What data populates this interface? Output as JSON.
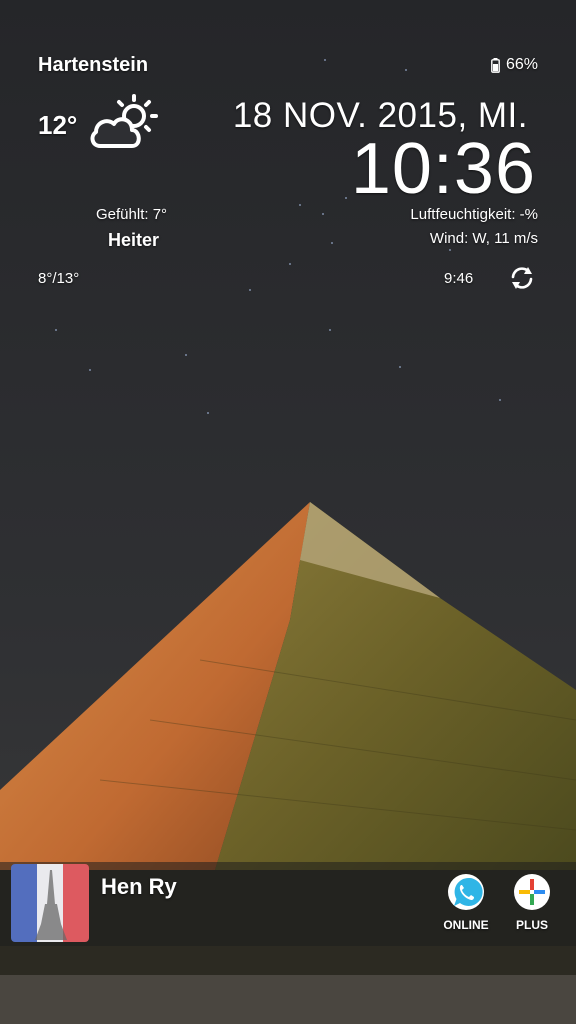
{
  "weather": {
    "location": "Hartenstein",
    "temperature": "12°",
    "feels_like": "Gefühlt: 7°",
    "condition": "Heiter",
    "min_max": "8°/13°",
    "humidity": "Luftfeuchtigkeit: -%",
    "wind": "Wind: W, 11 m/s",
    "updated": "9:46",
    "icon": "partly-sunny-icon"
  },
  "status": {
    "battery": "66%",
    "icon": "battery-icon"
  },
  "clock": {
    "date": "18 NOV. 2015, MI.",
    "time": "10:36"
  },
  "contact": {
    "name": "Hen Ry",
    "flag": "france-flag-eiffel-avatar"
  },
  "apps": [
    {
      "label": "ONLINE",
      "icon": "whatsapp-icon",
      "color": "#25d366"
    },
    {
      "label": "PLUS",
      "icon": "plus-messenger-icon",
      "color": "#ffffff"
    }
  ],
  "colors": {
    "sky": "#2a2b2e",
    "pyramid_lit": "#c9783a",
    "pyramid_shade": "#6d6326"
  }
}
